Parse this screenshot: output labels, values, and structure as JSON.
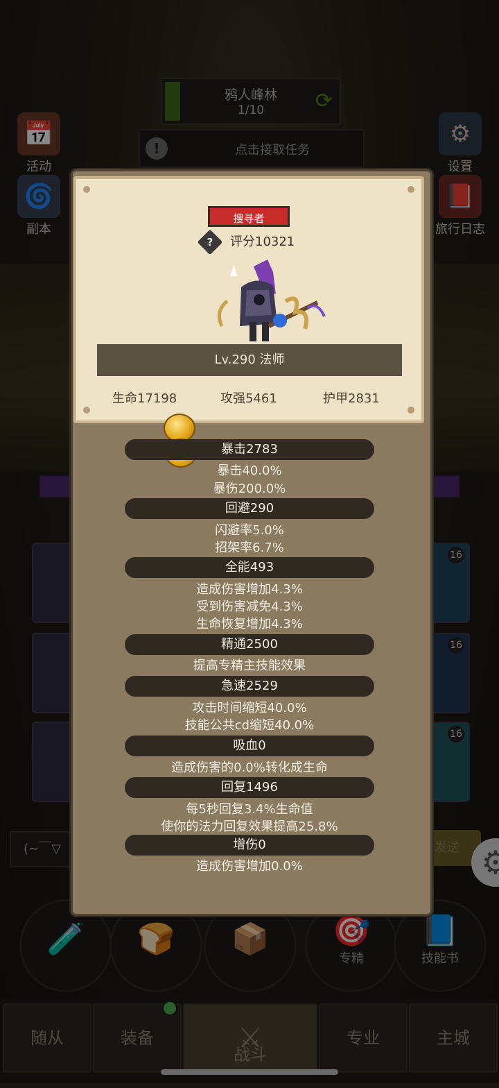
{
  "zone": {
    "name": "鸦人峰林",
    "progress": "1/10"
  },
  "quest": {
    "text": "点击接取任务"
  },
  "side_buttons": {
    "activity": "活动",
    "dungeon": "副本",
    "settings": "设置",
    "travel_log": "旅行日志"
  },
  "chat": {
    "text": "(~￣▽",
    "send": "发送"
  },
  "slot_levels": [
    "16",
    "16",
    "16"
  ],
  "skill_circles": {
    "specialize": "专精",
    "skill_book": "技能书"
  },
  "tabs": [
    "随从",
    "装备",
    "战斗",
    "专业",
    "主城"
  ],
  "character": {
    "tag": "搜寻者",
    "score": "评分10321",
    "level_class": "Lv.290 法师",
    "hp": "生命17198",
    "attack": "攻强5461",
    "armor": "护甲2831"
  },
  "attributes": [
    {
      "title": "暴击2783",
      "lines": [
        "暴击40.0%",
        "暴伤200.0%"
      ]
    },
    {
      "title": "回避290",
      "lines": [
        "闪避率5.0%",
        "招架率6.7%"
      ]
    },
    {
      "title": "全能493",
      "lines": [
        "造成伤害增加4.3%",
        "受到伤害减免4.3%",
        "生命恢复增加4.3%"
      ]
    },
    {
      "title": "精通2500",
      "lines": [
        "提高专精主技能效果"
      ]
    },
    {
      "title": "急速2529",
      "lines": [
        "攻击时间缩短40.0%",
        "技能公共cd缩短40.0%"
      ]
    },
    {
      "title": "吸血0",
      "lines": [
        "造成伤害的0.0%转化成生命"
      ]
    },
    {
      "title": "回复1496",
      "lines": [
        "每5秒回复3.4%生命值",
        "使你的法力回复效果提高25.8%"
      ]
    },
    {
      "title": "增伤0",
      "lines": [
        "造成伤害增加0.0%"
      ]
    }
  ],
  "colors": {
    "tag_red": "#c92a2a",
    "parchment": "#efe3c7",
    "modal": "#8b7b62"
  }
}
